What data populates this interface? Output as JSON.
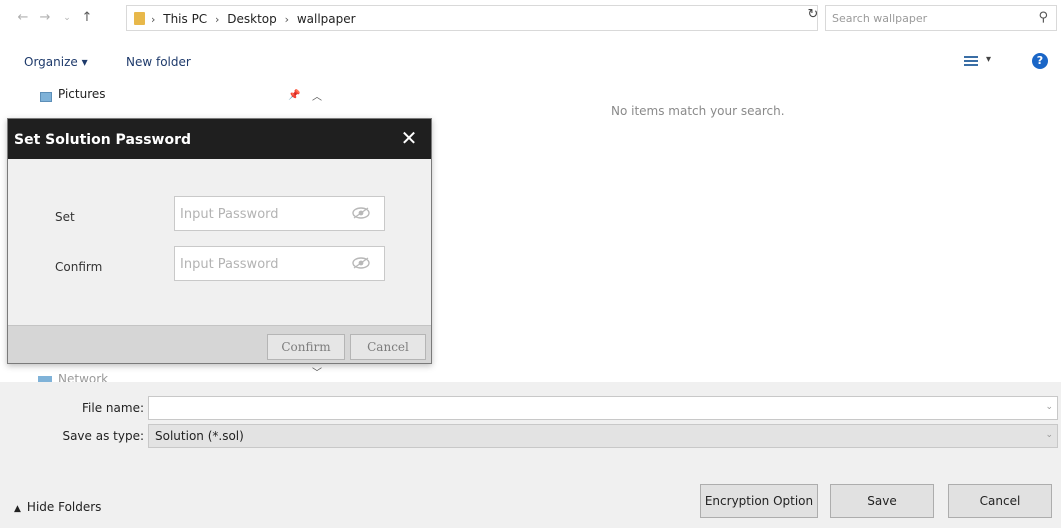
{
  "address_bar": {
    "breadcrumbs": [
      "This PC",
      "Desktop",
      "wallpaper"
    ],
    "search_placeholder": "Search wallpaper"
  },
  "toolbar": {
    "organize_label": "Organize ▾",
    "new_folder_label": "New folder"
  },
  "nav_pane": {
    "pictures_label": "Pictures",
    "network_label": "Network"
  },
  "content": {
    "empty_message": "No items match your search."
  },
  "dialog": {
    "title": "Set Solution Password",
    "close_glyph": "✕",
    "set_label": "Set",
    "confirm_label": "Confirm",
    "set_placeholder": "Input Password",
    "confirm_placeholder": "Input Password",
    "confirm_button": "Confirm",
    "cancel_button": "Cancel"
  },
  "file_form": {
    "file_name_label": "File name:",
    "file_name_value": "",
    "save_as_type_label": "Save as type:",
    "save_as_type_value": "Solution (*.sol)"
  },
  "footer": {
    "hide_folders_label": "Hide Folders",
    "encryption_button": "Encryption Option",
    "save_button": "Save",
    "cancel_button": "Cancel"
  },
  "colors": {
    "dialog_titlebar": "#1f1f1f",
    "link_blue": "#1e3a6b",
    "help_blue": "#1a66c7",
    "folder_yellow": "#e8b84a"
  }
}
